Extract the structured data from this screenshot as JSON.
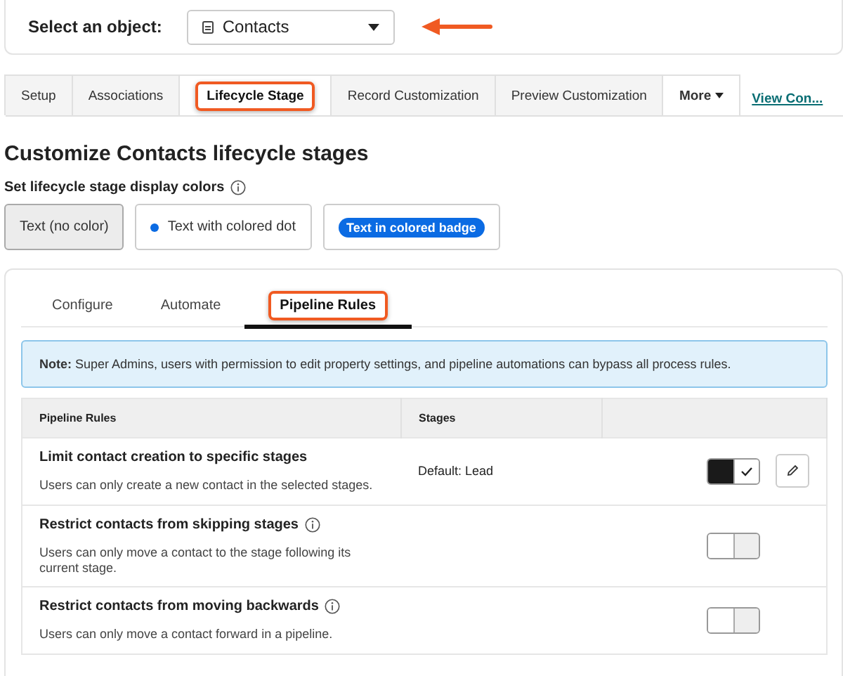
{
  "object_selector": {
    "label": "Select an object:",
    "value": "Contacts"
  },
  "tabs": [
    {
      "label": "Setup",
      "selected": false,
      "highlighted": false
    },
    {
      "label": "Associations",
      "selected": false,
      "highlighted": false
    },
    {
      "label": "Lifecycle Stage",
      "selected": true,
      "highlighted": true
    },
    {
      "label": "Record Customization",
      "selected": false,
      "highlighted": false
    },
    {
      "label": "Preview Customization",
      "selected": false,
      "highlighted": false
    },
    {
      "label": "More",
      "selected": false,
      "highlighted": false,
      "kind": "menu"
    }
  ],
  "view_link": "View Con...",
  "heading": "Customize Contacts lifecycle stages",
  "colors_label": "Set lifecycle stage display colors",
  "color_options": [
    {
      "label": "Text (no color)",
      "kind": "plain",
      "selected": true
    },
    {
      "label": "Text with colored dot",
      "kind": "dot",
      "selected": false,
      "color": "#0b6be3"
    },
    {
      "label": "Text in colored badge",
      "kind": "badge",
      "selected": false,
      "color": "#0b6be3"
    }
  ],
  "subtabs": [
    {
      "label": "Configure",
      "selected": false,
      "highlighted": false
    },
    {
      "label": "Automate",
      "selected": false,
      "highlighted": false
    },
    {
      "label": "Pipeline Rules",
      "selected": true,
      "highlighted": true
    }
  ],
  "note": "**Note:** Super Admins, users with permission to edit property settings, and pipeline automations can bypass all process rules.",
  "table": {
    "columns": [
      "Pipeline Rules",
      "Stages"
    ],
    "rows": [
      {
        "title": "Limit contact creation to specific stages",
        "info": false,
        "description": "Users can only create a new contact in the selected stages.",
        "stages": "Default: Lead",
        "on": true,
        "editable": true
      },
      {
        "title": "Restrict contacts from skipping stages",
        "info": true,
        "description": "Users can only move a contact to the stage following its current stage.",
        "on": false,
        "editable": false
      },
      {
        "title": "Restrict contacts from moving backwards",
        "info": true,
        "description": "Users can only move a contact forward in a pipeline.",
        "on": false,
        "editable": false
      }
    ]
  }
}
